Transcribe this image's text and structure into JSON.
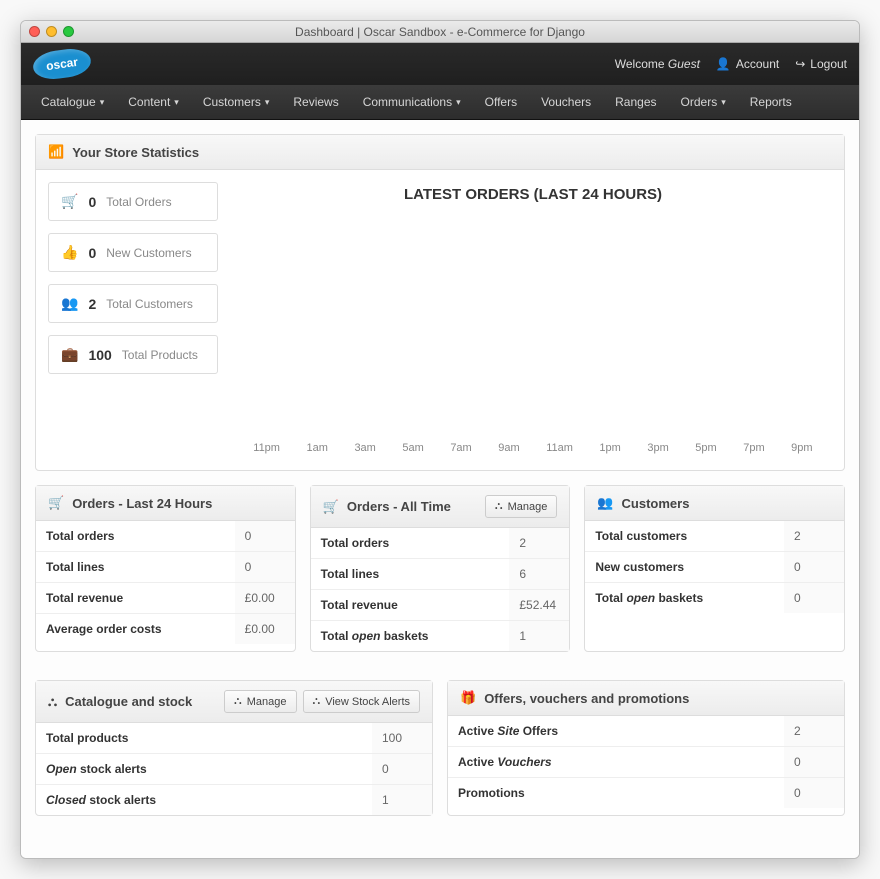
{
  "window_title": "Dashboard | Oscar Sandbox - e-Commerce for Django",
  "logo_text": "oscar",
  "header": {
    "welcome": "Welcome",
    "guest": "Guest",
    "account": "Account",
    "logout": "Logout"
  },
  "nav": {
    "catalogue": "Catalogue",
    "content": "Content",
    "customers": "Customers",
    "reviews": "Reviews",
    "communications": "Communications",
    "offers": "Offers",
    "vouchers": "Vouchers",
    "ranges": "Ranges",
    "orders": "Orders",
    "reports": "Reports"
  },
  "stats_panel": {
    "title": "Your Store Statistics",
    "cards": [
      {
        "icon": "cart",
        "value": "0",
        "label": "Total Orders"
      },
      {
        "icon": "thumbs",
        "value": "0",
        "label": "New Customers"
      },
      {
        "icon": "group",
        "value": "2",
        "label": "Total Customers"
      },
      {
        "icon": "case",
        "value": "100",
        "label": "Total Products"
      }
    ],
    "chart_title": "LATEST ORDERS (LAST 24 HOURS)"
  },
  "chart_data": {
    "type": "bar",
    "categories": [
      "11pm",
      "1am",
      "3am",
      "5am",
      "7am",
      "9am",
      "11am",
      "1pm",
      "3pm",
      "5pm",
      "7pm",
      "9pm"
    ],
    "values": [
      0,
      0,
      0,
      0,
      0,
      0,
      0,
      0,
      0,
      0,
      0,
      0
    ],
    "title": "LATEST ORDERS (LAST 24 HOURS)",
    "xlabel": "",
    "ylabel": "",
    "ylim": [
      0,
      1
    ]
  },
  "buttons": {
    "manage": "Manage",
    "view_alerts": "View Stock Alerts"
  },
  "orders24": {
    "title": "Orders - Last 24 Hours",
    "rows": [
      [
        "Total orders",
        "0"
      ],
      [
        "Total lines",
        "0"
      ],
      [
        "Total revenue",
        "£0.00"
      ],
      [
        "Average order costs",
        "£0.00"
      ]
    ]
  },
  "orders_all": {
    "title": "Orders - All Time",
    "rows": [
      [
        "Total orders",
        "2"
      ],
      [
        "Total lines",
        "6"
      ],
      [
        "Total revenue",
        "£52.44"
      ],
      [
        "Total <em>open</em> baskets",
        "1"
      ]
    ]
  },
  "customers": {
    "title": "Customers",
    "rows": [
      [
        "Total customers",
        "2"
      ],
      [
        "New customers",
        "0"
      ],
      [
        "Total <em>open</em> baskets",
        "0"
      ]
    ]
  },
  "catalogue": {
    "title": "Catalogue and stock",
    "rows": [
      [
        "Total products",
        "100"
      ],
      [
        "<em>Open</em> stock alerts",
        "0"
      ],
      [
        "<em>Closed</em> stock alerts",
        "1"
      ]
    ]
  },
  "promotions": {
    "title": "Offers, vouchers and promotions",
    "rows": [
      [
        "Active <em>Site</em> Offers",
        "2"
      ],
      [
        "Active <em>Vouchers</em>",
        "0"
      ],
      [
        "Promotions",
        "0"
      ]
    ]
  }
}
